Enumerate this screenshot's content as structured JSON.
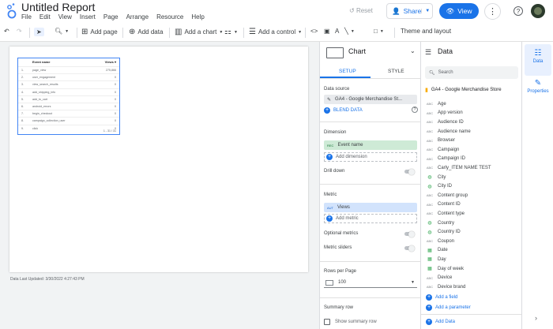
{
  "app": {
    "title": "Untitled Report",
    "menu": [
      "File",
      "Edit",
      "View",
      "Insert",
      "Page",
      "Arrange",
      "Resource",
      "Help"
    ],
    "reset_label": "Reset",
    "share_label": "Share",
    "view_label": "View"
  },
  "toolbar": {
    "add_page": "Add page",
    "add_data": "Add data",
    "add_chart": "Add a chart",
    "add_control": "Add a control",
    "theme": "Theme and layout"
  },
  "canvas": {
    "last_updated": "Data Last Updated: 3/30/2022 4:27:43 PM"
  },
  "table": {
    "headers": [
      "Event name",
      "Views ▾"
    ],
    "rows": [
      {
        "n": "1.",
        "name": "page_view",
        "value": "275,866"
      },
      {
        "n": "2.",
        "name": "user_engagement",
        "value": "0"
      },
      {
        "n": "3.",
        "name": "view_search_results",
        "value": "0"
      },
      {
        "n": "4.",
        "name": "add_shipping_info",
        "value": "0"
      },
      {
        "n": "5.",
        "name": "add_to_cart",
        "value": "0"
      },
      {
        "n": "6.",
        "name": "android_errors",
        "value": "0"
      },
      {
        "n": "7.",
        "name": "begin_checkout",
        "value": "0"
      },
      {
        "n": "8.",
        "name": "campaign_collection_user",
        "value": "0"
      },
      {
        "n": "9.",
        "name": "click",
        "value": "0"
      }
    ],
    "pagination": "1 - 31 / 31"
  },
  "chart_panel": {
    "title": "Chart",
    "tab_setup": "SETUP",
    "tab_style": "STYLE",
    "data_source_label": "Data source",
    "data_source": "GA4 - Google Merchandise St...",
    "blend": "BLEND DATA",
    "dimension_label": "Dimension",
    "dimension_type": "REC",
    "dimension": "Event name",
    "add_dimension": "Add dimension",
    "drill_down": "Drill down",
    "metric_label": "Metric",
    "metric_type": "AUT",
    "metric": "Views",
    "add_metric": "Add metric",
    "optional_metrics": "Optional metrics",
    "metric_sliders": "Metric sliders",
    "rows_per_page_label": "Rows per Page",
    "rows_per_page": "100",
    "summary_row_label": "Summary row",
    "show_summary_row": "Show summary row"
  },
  "data_panel": {
    "title": "Data",
    "search_placeholder": "Search",
    "source": "GA4 - Google Merchandise Store",
    "fields": [
      {
        "type": "ABC",
        "name": "Age"
      },
      {
        "type": "ABC",
        "name": "App version"
      },
      {
        "type": "ABC",
        "name": "Audience ID"
      },
      {
        "type": "ABC",
        "name": "Audience name"
      },
      {
        "type": "ABC",
        "name": "Browser"
      },
      {
        "type": "ABC",
        "name": "Campaign"
      },
      {
        "type": "ABC",
        "name": "Campaign ID"
      },
      {
        "type": "ABC",
        "name": "Carly_ITEM NAME TEST"
      },
      {
        "type": "geo",
        "name": "City"
      },
      {
        "type": "geo",
        "name": "City ID"
      },
      {
        "type": "ABC",
        "name": "Content group"
      },
      {
        "type": "ABC",
        "name": "Content ID"
      },
      {
        "type": "ABC",
        "name": "Content type"
      },
      {
        "type": "geo",
        "name": "Country"
      },
      {
        "type": "geo",
        "name": "Country ID"
      },
      {
        "type": "ABC",
        "name": "Coupon"
      },
      {
        "type": "cal",
        "name": "Date"
      },
      {
        "type": "cal",
        "name": "Day"
      },
      {
        "type": "cal",
        "name": "Day of week"
      },
      {
        "type": "ABC",
        "name": "Device"
      },
      {
        "type": "ABC",
        "name": "Device brand"
      }
    ],
    "add_field": "Add a field",
    "add_parameter": "Add a parameter",
    "add_data": "Add Data"
  },
  "right_rail": {
    "data": "Data",
    "properties": "Properties"
  },
  "colors": {
    "accent": "#1a73e8",
    "dimension_chip": "#ceead6",
    "metric_chip": "#d2e3fc"
  }
}
